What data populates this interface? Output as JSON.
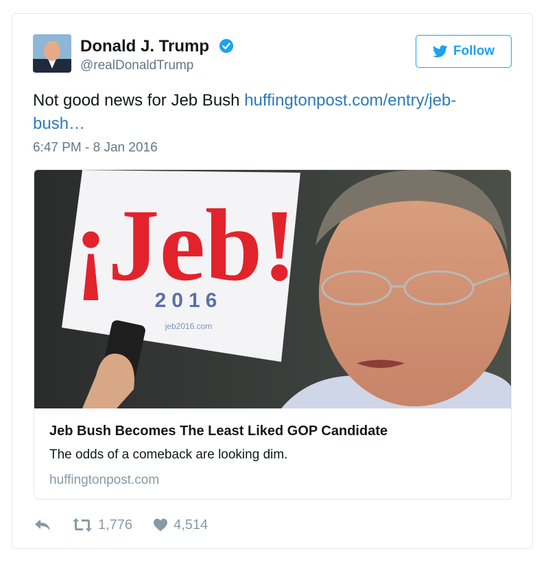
{
  "user": {
    "name": "Donald J. Trump",
    "handle": "@realDonaldTrump",
    "avatar_icon": "profile-photo",
    "verified_icon": "verified-badge-icon"
  },
  "follow_button": {
    "label": "Follow",
    "icon": "twitter-bird-icon"
  },
  "tweet": {
    "text": "Not good news for Jeb Bush ",
    "link_text": "huffingtonpost.com/entry/jeb-bush…",
    "timestamp": "6:47 PM - 8 Jan 2016"
  },
  "card": {
    "image_sign_text": "¡Jeb!",
    "image_sign_year": "2016",
    "image_sign_url": "jeb2016.com",
    "title": "Jeb Bush Becomes The Least Liked GOP Candidate",
    "description": "The odds of a comeback are looking dim.",
    "domain": "huffingtonpost.com"
  },
  "actions": {
    "reply_icon": "reply-icon",
    "retweet_icon": "retweet-icon",
    "retweet_count": "1,776",
    "like_icon": "heart-icon",
    "like_count": "4,514"
  },
  "colors": {
    "accent": "#1da1f2",
    "link": "#2b7bb9",
    "secondary_text": "#657786",
    "muted": "#8899a6",
    "sign_red": "#e3232b"
  }
}
